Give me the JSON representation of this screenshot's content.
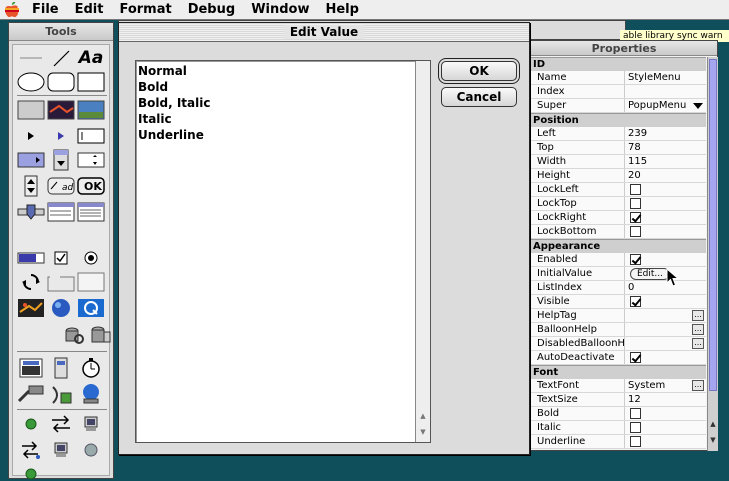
{
  "menubar": {
    "apple_icon": "apple-icon",
    "items": [
      "File",
      "Edit",
      "Format",
      "Debug",
      "Window",
      "Help"
    ]
  },
  "background": {
    "hint_text": "able library sync warn"
  },
  "tools": {
    "title": "Tools",
    "ok_label": "OK",
    "ad_label": "ad",
    "text_label": "Aa"
  },
  "dialog": {
    "title": "Edit Value",
    "values": [
      "Normal",
      "Bold",
      "Bold, Italic",
      "Italic",
      "Underline"
    ],
    "ok_label": "OK",
    "cancel_label": "Cancel"
  },
  "properties": {
    "title": "Properties",
    "sections": [
      {
        "name": "ID",
        "rows": [
          {
            "key": "Name",
            "value": "StyleMenu"
          },
          {
            "key": "Index",
            "value": ""
          },
          {
            "key": "Super",
            "value": "PopupMenu",
            "type": "dropdown"
          }
        ]
      },
      {
        "name": "Position",
        "rows": [
          {
            "key": "Left",
            "value": "239"
          },
          {
            "key": "Top",
            "value": "78"
          },
          {
            "key": "Width",
            "value": "115"
          },
          {
            "key": "Height",
            "value": "20"
          },
          {
            "key": "LockLeft",
            "type": "checkbox",
            "checked": false
          },
          {
            "key": "LockTop",
            "type": "checkbox",
            "checked": false
          },
          {
            "key": "LockRight",
            "type": "checkbox",
            "checked": true
          },
          {
            "key": "LockBottom",
            "type": "checkbox",
            "checked": false
          }
        ]
      },
      {
        "name": "Appearance",
        "rows": [
          {
            "key": "Enabled",
            "type": "checkbox",
            "checked": true
          },
          {
            "key": "InitialValue",
            "type": "button",
            "value": "Edit..."
          },
          {
            "key": "ListIndex",
            "value": "0"
          },
          {
            "key": "Visible",
            "type": "checkbox",
            "checked": true
          },
          {
            "key": "HelpTag",
            "type": "ellipsis",
            "value": ""
          },
          {
            "key": "BalloonHelp",
            "type": "ellipsis",
            "value": ""
          },
          {
            "key": "DisabledBalloonHelp",
            "type": "ellipsis",
            "value": ""
          },
          {
            "key": "AutoDeactivate",
            "type": "checkbox",
            "checked": true
          }
        ]
      },
      {
        "name": "Font",
        "rows": [
          {
            "key": "TextFont",
            "value": "System",
            "type": "ellipsis"
          },
          {
            "key": "TextSize",
            "value": "12"
          },
          {
            "key": "Bold",
            "type": "checkbox",
            "checked": false
          },
          {
            "key": "Italic",
            "type": "checkbox",
            "checked": false
          },
          {
            "key": "Underline",
            "type": "checkbox",
            "checked": false
          }
        ]
      }
    ]
  },
  "colors": {
    "desktop": "#0f4f5c",
    "scroll_thumb": "#a6a6f0",
    "hint_bg": "#ffffcc"
  }
}
